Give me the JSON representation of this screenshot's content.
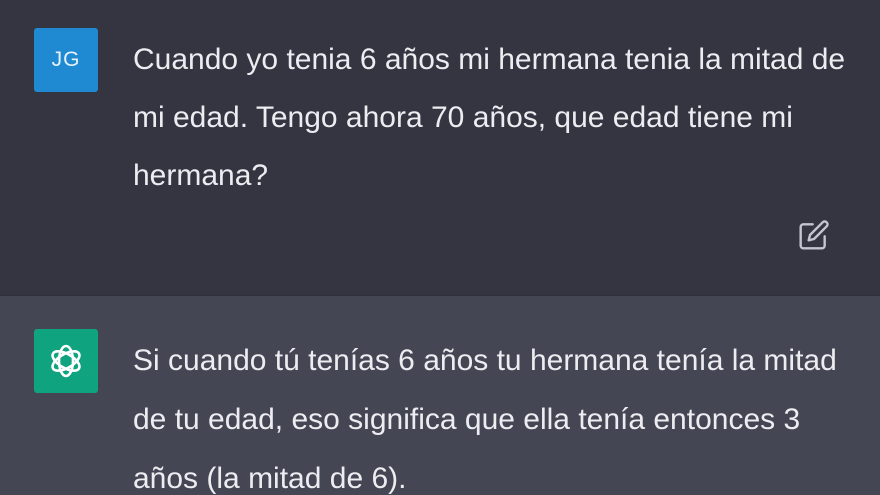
{
  "user_message": {
    "avatar_initials": "JG",
    "avatar_color": "#1f8ad2",
    "text": "Cuando yo tenia 6 años mi hermana tenia la mitad de mi edad. Tengo ahora 70 años, que edad tiene mi hermana?",
    "edit_icon": "edit-icon"
  },
  "assistant_message": {
    "avatar_icon": "openai-logo-icon",
    "avatar_color": "#10a37f",
    "text": "Si cuando tú tenías 6 años tu hermana tenía la mitad de tu edad, eso significa que ella tenía entonces 3 años (la mitad de 6)."
  },
  "colors": {
    "user_background": "#343541",
    "assistant_background": "#444654",
    "text": "#ececf1"
  }
}
